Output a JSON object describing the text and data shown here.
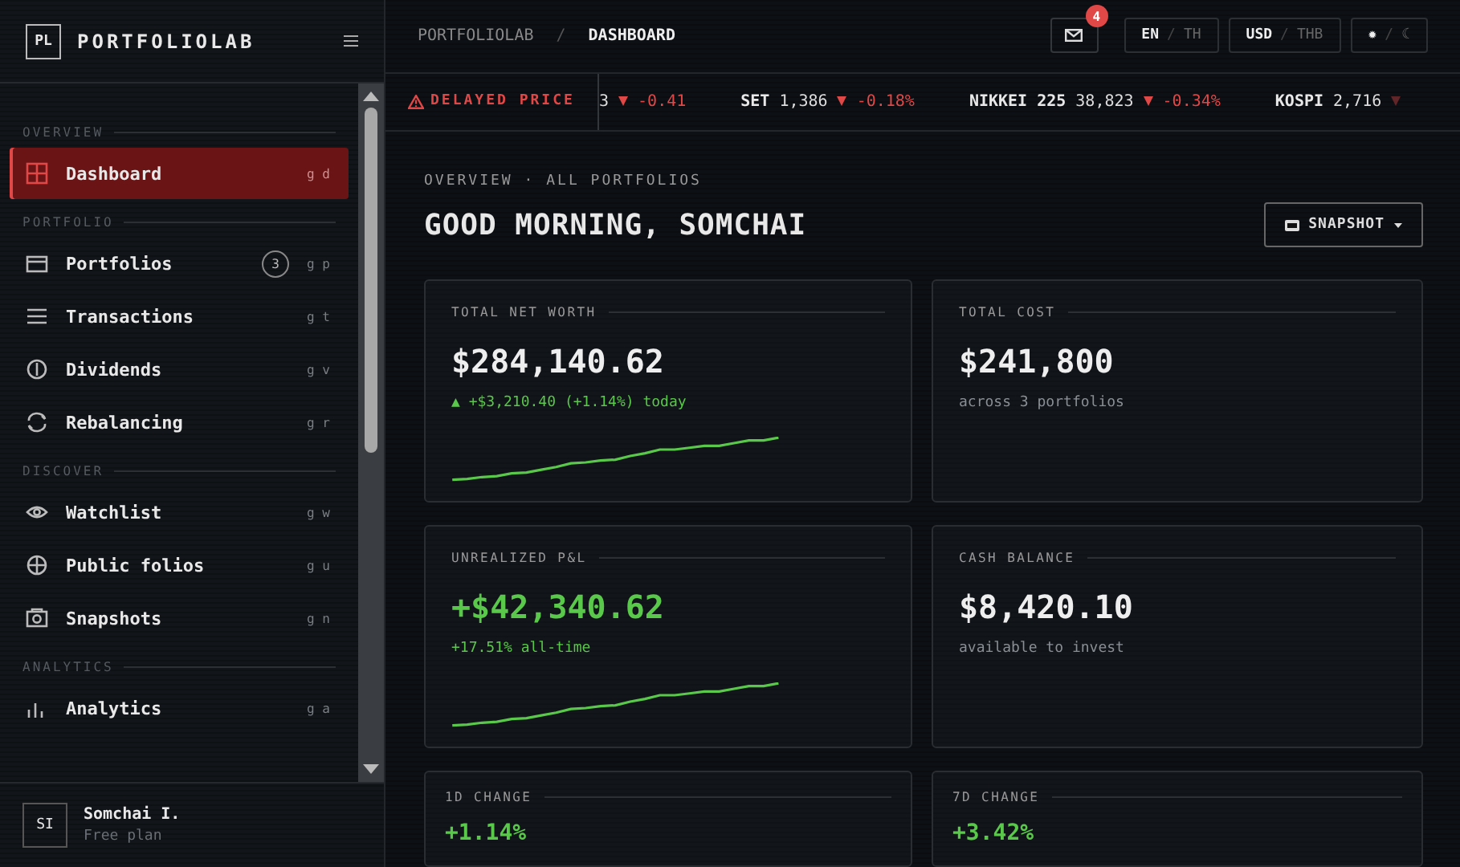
{
  "brand": {
    "logo": "PL",
    "name": "PORTFOLIOLAB"
  },
  "sidebar": {
    "sections": [
      {
        "title": "OVERVIEW",
        "items": [
          {
            "label": "Dashboard",
            "shortcut": "g d",
            "selected": true
          }
        ]
      },
      {
        "title": "PORTFOLIO",
        "items": [
          {
            "label": "Portfolios",
            "badge": "3",
            "shortcut": "g p",
            "selected": false
          },
          {
            "label": "Transactions",
            "shortcut": "g t",
            "selected": false
          },
          {
            "label": "Dividends",
            "shortcut": "g v",
            "selected": false
          },
          {
            "label": "Rebalancing",
            "shortcut": "g r",
            "selected": false
          }
        ]
      },
      {
        "title": "DISCOVER",
        "items": [
          {
            "label": "Watchlist",
            "shortcut": "g w",
            "selected": false
          },
          {
            "label": "Public folios",
            "shortcut": "g u",
            "selected": false
          },
          {
            "label": "Snapshots",
            "shortcut": "g n",
            "selected": false
          }
        ]
      },
      {
        "title": "ANALYTICS",
        "items": [
          {
            "label": "Analytics",
            "shortcut": "g a",
            "selected": false
          }
        ]
      }
    ],
    "user": {
      "initials": "SI",
      "name": "Somchai I.",
      "plan": "Free plan"
    }
  },
  "breadcrumb": {
    "items": [
      "PORTFOLIOLAB",
      "DASHBOARD"
    ],
    "separator": "/"
  },
  "inbox": {
    "badge": "4"
  },
  "toggles": [
    {
      "separator": "/",
      "options": [
        {
          "label": "EN",
          "selected": true
        },
        {
          "label": "TH",
          "selected": false
        }
      ]
    },
    {
      "separator": "/",
      "options": [
        {
          "label": "USD",
          "selected": true
        },
        {
          "label": "THB",
          "selected": false
        }
      ]
    },
    {
      "separator": "/",
      "options": [
        {
          "label": "✹",
          "selected": true
        },
        {
          "label": "☾",
          "selected": false
        }
      ]
    }
  ],
  "ticker": {
    "notice": "DELAYED PRICE",
    "items": [
      {
        "value": "3",
        "down": true,
        "change": "-0.41"
      },
      {
        "symbol": "SET",
        "value": "1,386",
        "down": true,
        "change": "-0.18%"
      },
      {
        "symbol": "NIKKEI 225",
        "value": "38,823",
        "down": true,
        "change": "-0.34%"
      },
      {
        "symbol": "KOSPI",
        "value": "2,716",
        "down": true
      }
    ]
  },
  "overview_label": "OVERVIEW · ALL PORTFOLIOS",
  "greeting": "GOOD MORNING, SOMCHAI",
  "snapshot_button": "SNAPSHOT",
  "cards": [
    {
      "title": "TOTAL NET WORTH",
      "value": "$284,140.62",
      "value_gain": false,
      "note": "▲ +$3,210.40 (+1.14%) today",
      "note_gain": true,
      "sparkline": true
    },
    {
      "title": "TOTAL COST",
      "value": "$241,800",
      "value_gain": false,
      "note": "across 3 portfolios",
      "note_gain": false,
      "sparkline": false
    },
    {
      "title": "UNREALIZED P&L",
      "value": "+$42,340.62",
      "value_gain": true,
      "note": "+17.51% all-time",
      "note_gain": true,
      "sparkline": true
    },
    {
      "title": "CASH BALANCE",
      "value": "$8,420.10",
      "value_gain": false,
      "note": "available to invest",
      "note_gain": false,
      "sparkline": false
    }
  ],
  "changes": [
    {
      "title": "1D CHANGE",
      "value": "+1.14%",
      "value_gain": true
    },
    {
      "title": "7D CHANGE",
      "value": "+3.42%",
      "value_gain": true
    }
  ]
}
